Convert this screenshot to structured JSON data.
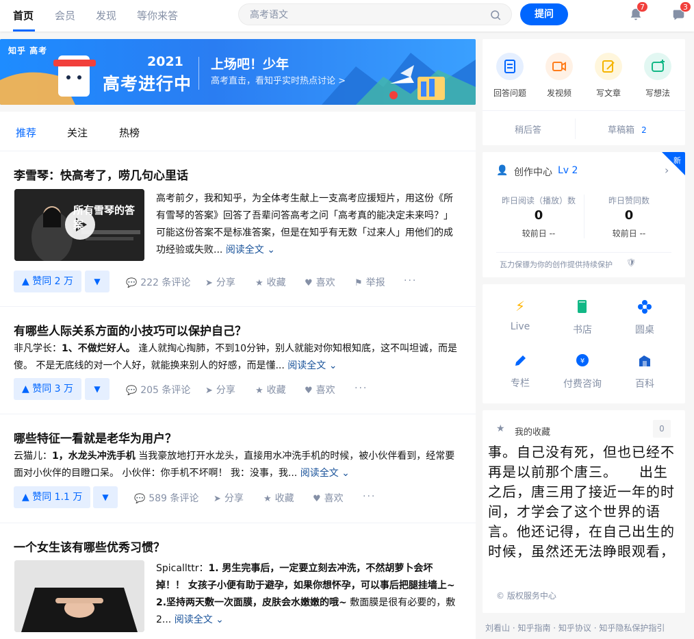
{
  "header": {
    "nav": [
      "首页",
      "会员",
      "发现",
      "等你来答"
    ],
    "search_placeholder": "高考语文",
    "ask_label": "提问",
    "notifications_count": "7",
    "messages_count": "3"
  },
  "banner": {
    "tag": "知乎 高考",
    "year": "2021",
    "title": "高考进行中",
    "slogan": "上场吧！少年",
    "subtitle": "高考直击，看知乎实时热点讨论 >"
  },
  "feed": {
    "tabs": [
      "推荐",
      "关注",
      "热榜"
    ],
    "items": [
      {
        "title": "李雪琴：快高考了，唠几句心里话",
        "thumb_caption": "所有雪琴的答案",
        "excerpt": "高考前夕，我和知乎，为全体考生献上一支高考应援短片，用这份《所有雪琴的答案》回答了吾辈问答高考之问「高考真的能决定未来吗？」可能这份答案不是标准答案，但是在知乎有无数「过来人」用他们的成功经验或失败...",
        "read_more": "阅读全文 ⌄",
        "vote": "赞同 2 万",
        "comments": "222 条评论",
        "share": "分享",
        "collect": "收藏",
        "like": "喜欢",
        "report": "举报"
      },
      {
        "title": "有哪些人际关系方面的小技巧可以保护自己？",
        "author": "非凡学长：",
        "excerpt_bold": "1、不做烂好人。",
        "excerpt": " 逢人就掏心掏肺，不到10分钟，别人就能对你知根知底，这不叫坦诚，而是傻。 不是无底线的对一个人好，就能换来别人的好感，而是懂...",
        "read_more": "阅读全文 ⌄",
        "vote": "赞同 3 万",
        "comments": "205 条评论",
        "share": "分享",
        "collect": "收藏",
        "like": "喜欢"
      },
      {
        "title": "哪些特征一看就是老华为用户？",
        "author": "云猫儿：",
        "excerpt_bold": "1，水龙头冲洗手机",
        "excerpt": " 当我豪放地打开水龙头，直接用水冲洗手机的时候，被小伙伴看到，经常要面对小伙伴的目瞪口呆。 小伙伴：你手机不坏啊！ 我：没事，我...",
        "read_more": "阅读全文 ⌄",
        "vote": "赞同 1.1 万",
        "comments": "589 条评论",
        "share": "分享",
        "collect": "收藏",
        "like": "喜欢"
      },
      {
        "title": "一个女生该有哪些优秀习惯？",
        "author": "Spicallttr：",
        "excerpt_bold": "1. 男生完事后，一定要立刻去冲洗，不然胡萝卜会坏掉！！ 女孩子小便有助于避孕，如果你想怀孕，可以事后把腿挂墙上~ 2.坚持两天敷一次面膜，皮肤会水嫩嫩的哦~",
        "excerpt": " 敷面膜是很有必要的，敷2...",
        "read_more": "阅读全文 ⌄"
      }
    ]
  },
  "sidebar": {
    "create": {
      "items": [
        "回答问题",
        "发视频",
        "写文章",
        "写想法"
      ],
      "later": "稍后答",
      "drafts": "草稿箱",
      "drafts_count": "2"
    },
    "creation_center": {
      "title": "创作中心",
      "level": "Lv 2",
      "new_tag": "新",
      "read_label": "昨日阅读（播放）数",
      "read_value": "0",
      "read_cmp": "较前日 --",
      "like_label": "昨日赞同数",
      "like_value": "0",
      "like_cmp": "较前日 --",
      "protect": "瓦力保镖为你的创作提供持续保护"
    },
    "tools": [
      "Live",
      "书店",
      "圆桌",
      "专栏",
      "付费咨询",
      "百科"
    ],
    "favorites": {
      "label": "我的收藏",
      "count": "0",
      "partial": "版权服务中心"
    },
    "novel_text": "事。自己没有死，但也已经不再是以前那个唐三。　　出生之后，唐三用了接近一年的时间，才学会了这个世界的语言。他还记得，在自己出生的时候，虽然还无法睁眼观看，",
    "footer": "刘看山 · 知乎指南 · 知乎协议 · 知乎隐私保护指引"
  },
  "colors": {
    "brand": "#0066ff",
    "badge": "#f1403c",
    "link": "#175199"
  }
}
